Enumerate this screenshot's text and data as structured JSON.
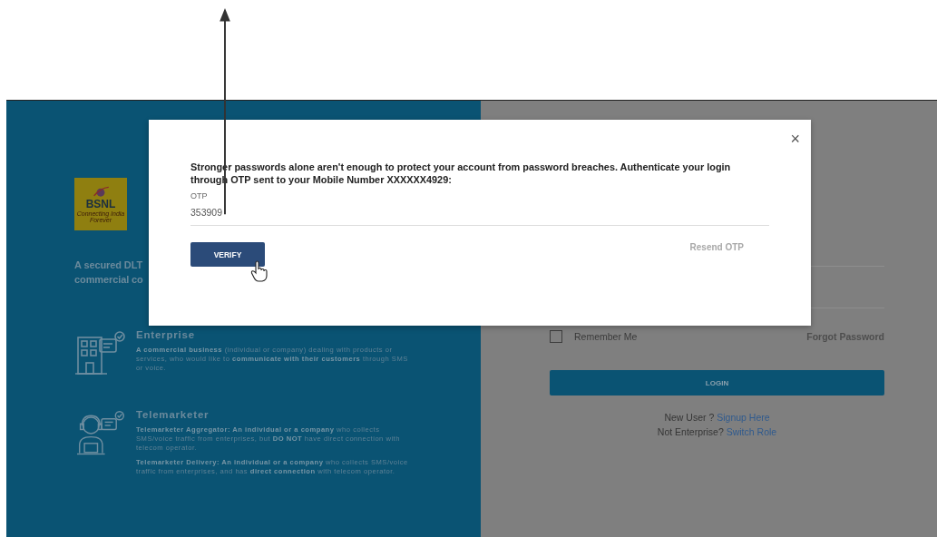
{
  "left_panel": {
    "logo": {
      "name": "BSNL",
      "slogan": "Connecting India Forever"
    },
    "intro_lines": [
      "A secured DLT",
      "commercial co"
    ],
    "roles": [
      {
        "kind": "enterprise",
        "title": "Enterprise",
        "paragraphs": [
          "**A commercial business** (individual or company) dealing with products or services, who would like to **communicate with their customers** through SMS or voice."
        ]
      },
      {
        "kind": "telemarketer",
        "title": "Telemarketer",
        "paragraphs": [
          "**Telemarketer Aggregator: An individual or a company** who collects SMS/voice traffic from enterprises, but **DO NOT** have direct connection with telecom operator.",
          "**Telemarketer Delivery: An individual or a company** who collects SMS/voice traffic from enterprises, and has **direct connection** with telecom operator."
        ]
      }
    ]
  },
  "right_panel": {
    "remember": {
      "label": "Remember Me",
      "checked": false
    },
    "forgot_link": "Forgot Password",
    "login_button": "LOGIN",
    "signup": {
      "text": "New User ?",
      "link": "Signup Here"
    },
    "switch_role": {
      "text": "Not Enterprise?",
      "link": "Switch Role"
    }
  },
  "modal": {
    "close": "×",
    "message": "Stronger passwords alone aren't enough to protect your account from password breaches. Authenticate your login through OTP sent to your Mobile Number XXXXXX4929:",
    "otp_field": {
      "label": "OTP",
      "value": "353909"
    },
    "verify_button": "VERIFY",
    "resend_link": "Resend OTP"
  }
}
